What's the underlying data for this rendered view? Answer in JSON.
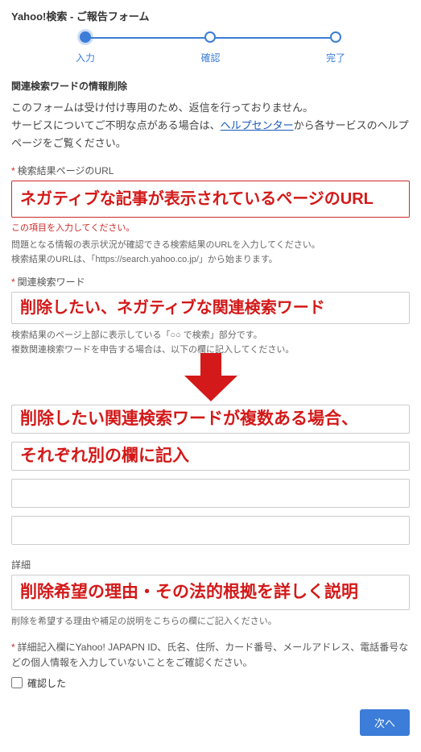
{
  "page_title": "Yahoo!検索 - ご報告フォーム",
  "stepper": {
    "steps": [
      "入力",
      "確認",
      "完了"
    ],
    "active_index": 0
  },
  "section_heading": "関連検索ワードの情報削除",
  "intro": {
    "line1": "このフォームは受け付け専用のため、返信を行っておりません。",
    "line2a": "サービスについてご不明な点がある場合は、",
    "link": "ヘルプセンター",
    "line2b": "から各サービスのヘルプページをご覧ください。"
  },
  "url_field": {
    "label": "検索結果ページのURL",
    "annotation": "ネガティブな記事が表示されているページのURL",
    "error": "この項目を入力してください。",
    "help1": "問題となる情報の表示状況が確認できる検索結果のURLを入力してください。",
    "help2": "検索結果のURLは、「https://search.yahoo.co.jp/」から始まります。"
  },
  "keyword_field": {
    "label": "関連検索ワード",
    "annotation_main": "削除したい、ネガティブな関連検索ワード",
    "help1": "検索結果のページ上部に表示している「○○ で検索」部分です。",
    "help2": "複数関連検索ワードを申告する場合は、以下の欄に記入してください。",
    "annotation_b1": "削除したい関連検索ワードが複数ある場合、",
    "annotation_b2": "それぞれ別の欄に記入"
  },
  "details_field": {
    "label": "詳細",
    "annotation": "削除希望の理由・その法的根拠を詳しく説明",
    "help": "削除を希望する理由や補足の説明をこちらの欄にご記入ください。"
  },
  "confirm": {
    "note": "詳細記入欄にYahoo! JAPAPN ID、氏名、住所、カード番号、メールアドレス、電話番号などの個人情報を入力していないことをご確認ください。",
    "checkbox_label": "確認した"
  },
  "next_button": "次へ"
}
